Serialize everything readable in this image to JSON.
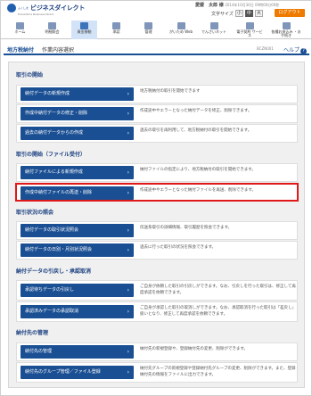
{
  "header": {
    "logo_small": "ふくしま",
    "logo_big": "ビジネスダイレクト",
    "logo_sub": "Fukushima Business Direct",
    "user_label": "愛媛　太郎 様",
    "last_login": "2014年10月30日 09時00分00秒",
    "font_size_label": "文字サイズ",
    "font_sizes": [
      "小",
      "中",
      "大"
    ],
    "logout_label": "ログアウト"
  },
  "nav": [
    {
      "label": "ホーム",
      "icon": "home-icon"
    },
    {
      "label": "明細照会",
      "icon": "statement-icon"
    },
    {
      "label": "資金移動",
      "icon": "transfer-icon",
      "active": true
    },
    {
      "label": "承認",
      "icon": "approval-icon"
    },
    {
      "label": "管理",
      "icon": "management-icon"
    },
    {
      "label": "がいため Web",
      "icon": "forex-icon"
    },
    {
      "label": "でんさいネット",
      "icon": "densai-icon"
    },
    {
      "label": "電子契約 サービス",
      "icon": "contract-icon"
    },
    {
      "label": "各種お申込み ・お手続き",
      "icon": "application-icon"
    }
  ],
  "title": {
    "main": "地方税納付",
    "sub": "作業内容選択",
    "code": "BCZN001",
    "help": "ヘルプ"
  },
  "sections": {
    "s1": {
      "head": "取引の開始",
      "rows": [
        {
          "button": "納付データの新規作成",
          "desc": "地方税納付の取引を開始できます"
        },
        {
          "button": "作成中納付データの修正・削除",
          "desc": "作成途中やエラーとなった納付データを修正、削除できます。"
        },
        {
          "button": "過去の納付データからの作成",
          "desc": "過去の取引を再利用して、地方税納付の取引を開始できます。"
        }
      ]
    },
    "s2": {
      "head": "取引の開始（ファイル受付）",
      "rows": [
        {
          "button": "納付ファイルによる新規作成",
          "desc": "納付ファイルの指定により、地方税納付の取引を開始できます。"
        },
        {
          "button": "作成中納付ファイルの再送・削除",
          "desc": "作成途中やエラーとなった納付ファイルを再送、削除できます。"
        }
      ]
    },
    "s3": {
      "head": "取引状況の照会",
      "rows": [
        {
          "button": "納付データの取引状況照会",
          "desc": "伝送系取引の詳細情報、取引履歴を照会できます。"
        },
        {
          "button": "納付データの日別・月別状況照会",
          "desc": "過去に行った取引の状況を照会できます。"
        }
      ]
    },
    "s4": {
      "head": "納付データの引戻し・承認取消",
      "rows": [
        {
          "button": "承認待ちデータの引戻し",
          "desc": "ご自身が依頼した取引の引戻しができます。なお、引戻しを行った取引は、修正して再度承認を依頼できます。"
        },
        {
          "button": "承認済みデータの承認取消",
          "desc": "ご自身が承認した取引の取消しができます。なお、承認取消を行った取引は「差戻し」扱いとなり、修正して再度承認を依頼できます。"
        }
      ]
    },
    "s5": {
      "head": "納付先の管理",
      "rows": [
        {
          "button": "納付先の管理",
          "desc": "納付先の新規登録や、登録納付先の変更、削除ができます。"
        },
        {
          "button": "納付先のグループ管理／ファイル登録",
          "desc": "納付先グループの新規登録や登録納付先グループの変更、削除ができます。また、登録納付先の情報をファイルに出力できます。"
        }
      ]
    }
  },
  "colors": {
    "primary": "#1a4f93",
    "logout": "#ee7a00",
    "highlight": "#e01818"
  }
}
